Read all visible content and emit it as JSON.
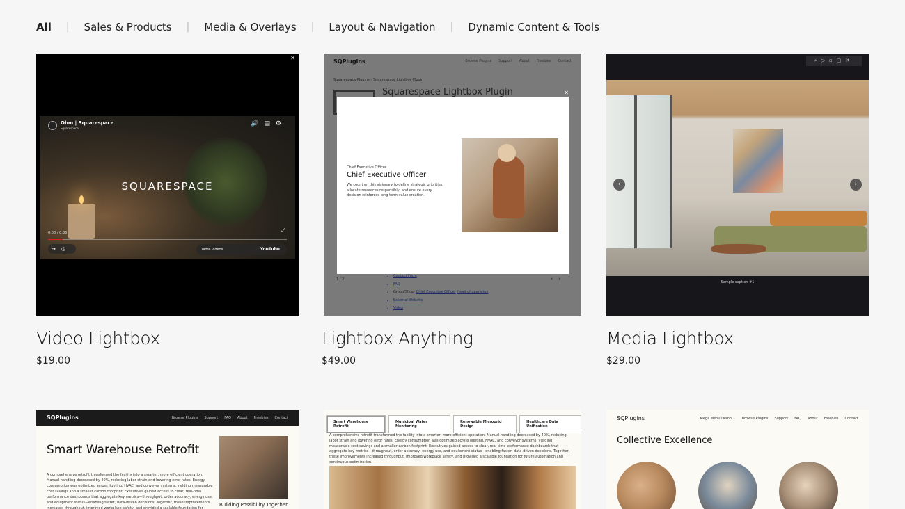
{
  "filters": {
    "items": [
      {
        "label": "All"
      },
      {
        "label": "Sales & Products"
      },
      {
        "label": "Media & Overlays"
      },
      {
        "label": "Layout & Navigation"
      },
      {
        "label": "Dynamic Content & Tools"
      }
    ],
    "separator": "|"
  },
  "products": [
    {
      "title": "Video Lightbox",
      "price": "$19.00"
    },
    {
      "title": "Lightbox Anything",
      "price": "$49.00"
    },
    {
      "title": "Media Lightbox",
      "price": "$29.00"
    }
  ],
  "video_preview": {
    "channel": "Ohm | Squarespace",
    "channel_sub": "Squarespace",
    "logo": "SQUARESPACE",
    "time": "0:00 / 0:36",
    "more_videos": "More videos",
    "youtube": "YouTube",
    "progress": 0.06
  },
  "anything_preview": {
    "logo": "SQPlugins",
    "nav": [
      "Browse Plugins",
      "Support",
      "About",
      "Freebies",
      "Contact"
    ],
    "breadcrumb": "Squarespace Plugins  ›  Squarespace Lightbox Plugin",
    "bg_title": "Squarespace Lightbox Plugin",
    "modal_role": "Chief Executive Officer",
    "modal_title": "Chief Executive Officer",
    "modal_body": "We count on this visionary to define strategic priorities, allocate resources responsibly, and ensure every decision reinforces long-term value creation.",
    "counter": "1 / 2",
    "list": [
      "Contact Form",
      "FAQ",
      "Group/Slider",
      "Chief Executive Officer",
      "Head of operation",
      "External Website",
      "Video"
    ]
  },
  "media_preview": {
    "caption": "Sample caption #1"
  },
  "bottom_previews": {
    "warehouse": {
      "logo": "SQPlugins",
      "nav": [
        "Browse Plugins",
        "Support",
        "FAQ",
        "About",
        "Freebies",
        "Contact"
      ],
      "title": "Smart Warehouse Retrofit",
      "body": "A comprehensive retrofit transformed the facility into a smarter, more efficient operation. Manual handling decreased by 40%, reducing labor strain and lowering error rates. Energy consumption was optimized across lighting, HVAC, and conveyor systems, yielding measurable cost savings and a smaller carbon footprint. Executives gained access to clear, real-time performance dashboards that aggregate key metrics—throughput, order accuracy, energy use, and equipment status—enabling faster, data-driven decisions. Together, these improvements increased throughput, improved workplace safety, and provided a scalable foundation for future automation and continuous optimization.",
      "caption": "Building Possibility Together"
    },
    "tabs": {
      "items": [
        "Smart Warehouse Retrofit",
        "Municipal Water Monitoring",
        "Renewable Microgrid Design",
        "Healthcare Data Unification"
      ],
      "body": "A comprehensive retrofit transformed the facility into a smarter, more efficient operation. Manual handling decreased by 40%, reducing labor strain and lowering error rates. Energy consumption was optimized across lighting, HVAC, and conveyor systems, yielding measurable cost savings and a smaller carbon footprint. Executives gained access to clear, real-time performance dashboards that aggregate key metrics—throughput, order accuracy, energy use, and equipment status—enabling faster, data-driven decisions. Together, these improvements increased throughput, improved workplace safety, and provided a scalable foundation for future automation and continuous optimization."
    },
    "mega": {
      "logo": "SQPlugins",
      "nav": [
        "Mega Menu Demo ⌄",
        "Browse Plugins",
        "Support",
        "FAQ",
        "About",
        "Freebies",
        "Contact"
      ],
      "title": "Collective Excellence"
    }
  }
}
